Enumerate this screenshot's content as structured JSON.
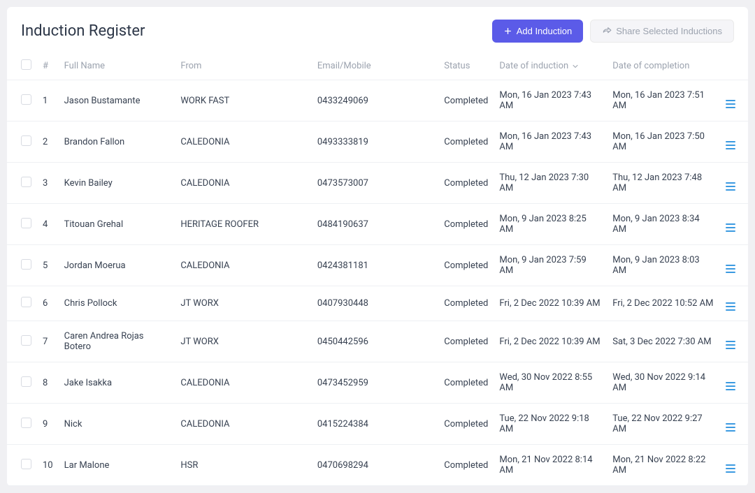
{
  "page_title": "Induction Register",
  "actions": {
    "add_label": "Add Induction",
    "share_label": "Share Selected Inductions"
  },
  "columns": {
    "num": "#",
    "full_name": "Full Name",
    "from": "From",
    "email_mobile": "Email/Mobile",
    "status": "Status",
    "date_induction": "Date of induction",
    "date_completion": "Date of completion"
  },
  "rows": [
    {
      "num": "1",
      "name": "Jason Bustamante",
      "from": "WORK FAST",
      "contact": "0433249069",
      "status": "Completed",
      "induction": "Mon, 16 Jan 2023 7:43 AM",
      "completion": "Mon, 16 Jan 2023 7:51 AM"
    },
    {
      "num": "2",
      "name": "Brandon Fallon",
      "from": "CALEDONIA",
      "contact": "0493333819",
      "status": "Completed",
      "induction": "Mon, 16 Jan 2023 7:43 AM",
      "completion": "Mon, 16 Jan 2023 7:50 AM"
    },
    {
      "num": "3",
      "name": "Kevin Bailey",
      "from": "CALEDONIA",
      "contact": "0473573007",
      "status": "Completed",
      "induction": "Thu, 12 Jan 2023 7:30 AM",
      "completion": "Thu, 12 Jan 2023 7:48 AM"
    },
    {
      "num": "4",
      "name": "Titouan Grehal",
      "from": "HERITAGE ROOFER",
      "contact": "0484190637",
      "status": "Completed",
      "induction": "Mon, 9 Jan 2023 8:25 AM",
      "completion": "Mon, 9 Jan 2023 8:34 AM"
    },
    {
      "num": "5",
      "name": "Jordan Moerua",
      "from": "CALEDONIA",
      "contact": "0424381181",
      "status": "Completed",
      "induction": "Mon, 9 Jan 2023 7:59 AM",
      "completion": "Mon, 9 Jan 2023 8:03 AM"
    },
    {
      "num": "6",
      "name": "Chris Pollock",
      "from": "JT WORX",
      "contact": "0407930448",
      "status": "Completed",
      "induction": "Fri, 2 Dec 2022 10:39 AM",
      "completion": "Fri, 2 Dec 2022 10:52 AM"
    },
    {
      "num": "7",
      "name": "Caren Andrea Rojas Botero",
      "from": "JT WORX",
      "contact": "0450442596",
      "status": "Completed",
      "induction": "Fri, 2 Dec 2022 10:39 AM",
      "completion": "Sat, 3 Dec 2022 7:30 AM"
    },
    {
      "num": "8",
      "name": "Jake Isakka",
      "from": "CALEDONIA",
      "contact": "0473452959",
      "status": "Completed",
      "induction": "Wed, 30 Nov 2022 8:55 AM",
      "completion": "Wed, 30 Nov 2022 9:14 AM"
    },
    {
      "num": "9",
      "name": "Nick",
      "from": "CALEDONIA",
      "contact": "0415224384",
      "status": "Completed",
      "induction": "Tue, 22 Nov 2022 9:18 AM",
      "completion": "Tue, 22 Nov 2022 9:27 AM"
    },
    {
      "num": "10",
      "name": "Lar Malone",
      "from": "HSR",
      "contact": "0470698294",
      "status": "Completed",
      "induction": "Mon, 21 Nov 2022 8:14 AM",
      "completion": "Mon, 21 Nov 2022 8:22 AM"
    }
  ]
}
